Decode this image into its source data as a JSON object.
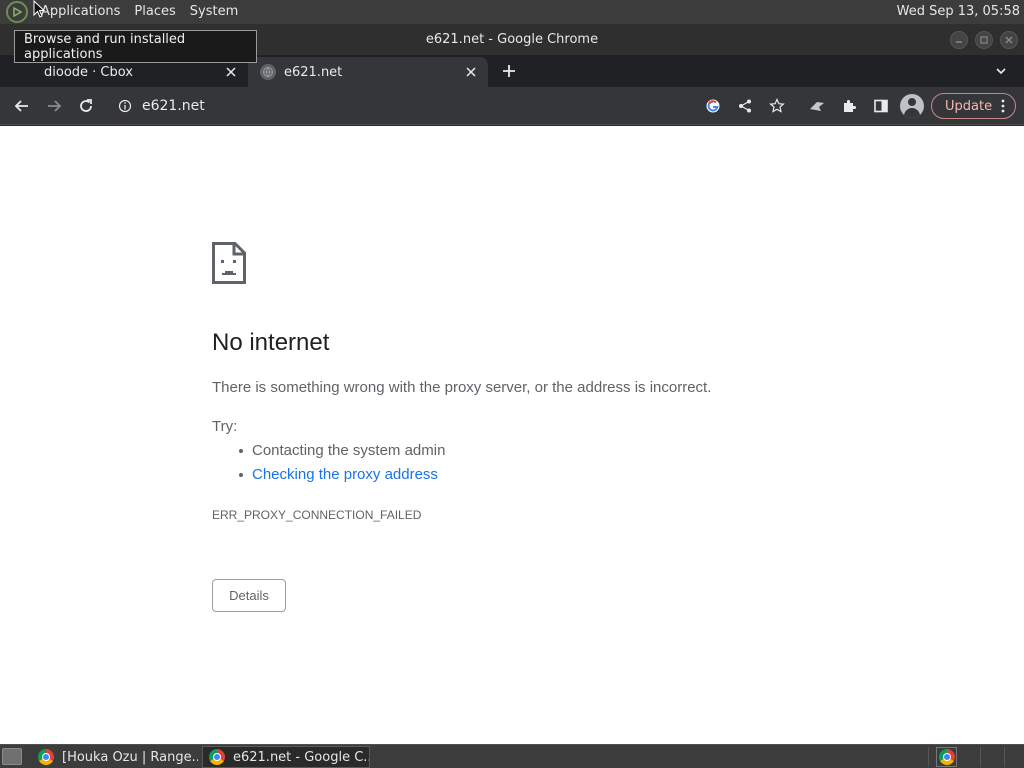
{
  "desktop_panel": {
    "menus": [
      "Applications",
      "Places",
      "System"
    ],
    "clock": "Wed Sep 13, 05:58",
    "tooltip": "Browse and run installed applications"
  },
  "window": {
    "title": "e621.net - Google Chrome"
  },
  "tabs": [
    {
      "label": "dioode · Cbox",
      "active": false
    },
    {
      "label": "e621.net",
      "active": true
    }
  ],
  "toolbar": {
    "url": "e621.net",
    "update_label": "Update"
  },
  "error_page": {
    "title": "No internet",
    "description": "There is something wrong with the proxy server, or the address is incorrect.",
    "try_label": "Try:",
    "suggestions": [
      {
        "text": "Contacting the system admin",
        "link": false
      },
      {
        "text": "Checking the proxy address",
        "link": true
      }
    ],
    "error_code": "ERR_PROXY_CONNECTION_FAILED",
    "details_label": "Details",
    "link_color": "#1a73e8"
  },
  "taskbar": {
    "tasks": [
      {
        "label": "[Houka Ozu | Range...",
        "active": false
      },
      {
        "label": "e621.net - Google C...",
        "active": true
      }
    ]
  }
}
